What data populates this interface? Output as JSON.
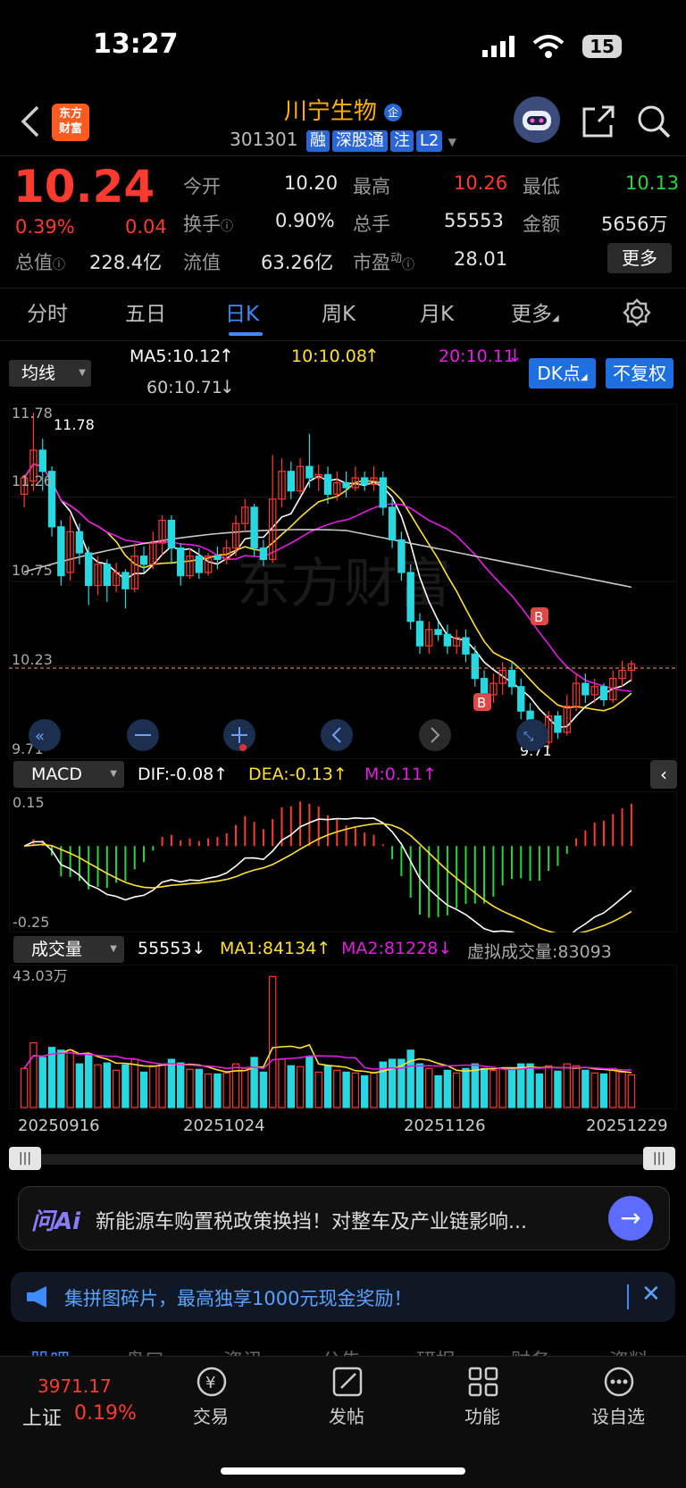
{
  "status": {
    "time": "13:27",
    "battery": "15"
  },
  "header": {
    "logo_line1": "东方",
    "logo_line2": "财富",
    "name": "川宁生物",
    "name_badge": "企",
    "code": "301301",
    "tags": [
      "融",
      "深股通",
      "注",
      "L2"
    ]
  },
  "quote": {
    "price": "10.24",
    "change_pct": "0.39%",
    "change": "0.04",
    "open_label": "今开",
    "open": "10.20",
    "high_label": "最高",
    "high": "10.26",
    "low_label": "最低",
    "low": "10.13",
    "turnover_label": "换手",
    "turnover": "0.90%",
    "volume_label": "总手",
    "volume": "55553",
    "amount_label": "金额",
    "amount": "5656万",
    "mcap_label": "总值",
    "mcap": "228.4亿",
    "float_label": "流值",
    "float": "63.26亿",
    "pe_label": "市盈",
    "pe_sup": "动",
    "pe": "28.01",
    "more_button": "更多"
  },
  "tabs": [
    "分时",
    "五日",
    "日K",
    "周K",
    "月K",
    "更多"
  ],
  "active_tab": "日K",
  "kline": {
    "ma_select": "均线",
    "ma5": "MA5:10.12",
    "ma10": "10:10.08",
    "ma20": "20:10.11",
    "ma60": "60:10.71",
    "dk_button": "DK点",
    "fq_button": "不复权",
    "y_labels": [
      "11.78",
      "11.26",
      "10.75",
      "10.23",
      "9.71"
    ],
    "max_label": "11.78",
    "min_label": "9.71",
    "watermark": "东方财富",
    "b_marker": "B",
    "colors": {
      "up": "#ff3b30",
      "down": "#28d8e0",
      "ma5": "#ffffff",
      "ma10": "#ffe033",
      "ma20": "#e020e0",
      "ma60": "#c8c8c8"
    }
  },
  "chart_data": [
    {
      "type": "candlestick",
      "y_range": [
        9.71,
        11.78
      ],
      "x_labels": [
        "20250916",
        "20251024",
        "20251126",
        "20251229"
      ],
      "max_price": 11.78,
      "min_price": 9.71,
      "last_close": 10.24,
      "ma": {
        "ma5": 10.12,
        "ma10": 10.08,
        "ma20": 10.11,
        "ma60": 10.71
      },
      "candles": [
        [
          11.28,
          11.38,
          11.4,
          11.2
        ],
        [
          11.36,
          11.55,
          11.78,
          11.3
        ],
        [
          11.55,
          11.42,
          11.62,
          11.3
        ],
        [
          11.42,
          11.08,
          11.45,
          11.02
        ],
        [
          11.08,
          10.78,
          11.12,
          10.72
        ],
        [
          10.8,
          11.05,
          11.15,
          10.75
        ],
        [
          11.05,
          10.92,
          11.1,
          10.85
        ],
        [
          10.92,
          10.72,
          10.96,
          10.6
        ],
        [
          10.72,
          10.85,
          10.9,
          10.66
        ],
        [
          10.85,
          10.72,
          10.88,
          10.62
        ],
        [
          10.72,
          10.8,
          10.86,
          10.68
        ],
        [
          10.8,
          10.7,
          10.82,
          10.58
        ],
        [
          10.7,
          10.9,
          10.98,
          10.68
        ],
        [
          10.9,
          10.85,
          10.96,
          10.8
        ],
        [
          10.85,
          10.98,
          11.05,
          10.82
        ],
        [
          10.98,
          11.12,
          11.15,
          10.9
        ],
        [
          11.12,
          10.95,
          11.15,
          10.85
        ],
        [
          10.95,
          10.78,
          10.98,
          10.72
        ],
        [
          10.78,
          10.9,
          10.95,
          10.76
        ],
        [
          10.9,
          10.8,
          10.95,
          10.76
        ],
        [
          10.8,
          10.9,
          10.92,
          10.78
        ],
        [
          10.9,
          10.88,
          10.96,
          10.82
        ],
        [
          10.88,
          10.95,
          11.0,
          10.85
        ],
        [
          10.95,
          11.1,
          11.15,
          10.9
        ],
        [
          11.1,
          11.2,
          11.25,
          11.05
        ],
        [
          11.2,
          10.95,
          11.22,
          10.9
        ],
        [
          10.95,
          10.88,
          11.0,
          10.84
        ],
        [
          10.88,
          11.25,
          11.52,
          10.86
        ],
        [
          11.25,
          11.42,
          11.5,
          11.2
        ],
        [
          11.42,
          11.3,
          11.48,
          11.25
        ],
        [
          11.3,
          11.45,
          11.5,
          11.28
        ],
        [
          11.45,
          11.38,
          11.65,
          11.32
        ],
        [
          11.38,
          11.4,
          11.46,
          11.3
        ],
        [
          11.4,
          11.28,
          11.45,
          11.22
        ],
        [
          11.28,
          11.35,
          11.42,
          11.24
        ],
        [
          11.35,
          11.32,
          11.42,
          11.26
        ],
        [
          11.32,
          11.38,
          11.45,
          11.3
        ],
        [
          11.38,
          11.34,
          11.42,
          11.3
        ],
        [
          11.34,
          11.38,
          11.45,
          11.3
        ],
        [
          11.38,
          11.2,
          11.42,
          11.15
        ],
        [
          11.2,
          11.0,
          11.25,
          10.95
        ],
        [
          11.0,
          10.8,
          11.05,
          10.75
        ],
        [
          10.8,
          10.5,
          10.85,
          10.45
        ],
        [
          10.5,
          10.35,
          10.55,
          10.3
        ],
        [
          10.35,
          10.45,
          10.5,
          10.3
        ],
        [
          10.45,
          10.42,
          10.5,
          10.38
        ],
        [
          10.42,
          10.35,
          10.48,
          10.3
        ],
        [
          10.35,
          10.4,
          10.45,
          10.3
        ],
        [
          10.4,
          10.3,
          10.45,
          10.25
        ],
        [
          10.3,
          10.15,
          10.35,
          10.1
        ],
        [
          10.15,
          10.05,
          10.2,
          10.0
        ],
        [
          10.05,
          10.12,
          10.18,
          10.0
        ],
        [
          10.12,
          10.2,
          10.25,
          10.05
        ],
        [
          10.2,
          10.1,
          10.25,
          10.05
        ],
        [
          10.1,
          9.95,
          10.15,
          9.9
        ],
        [
          9.95,
          9.8,
          10.0,
          9.75
        ],
        [
          9.8,
          9.76,
          9.85,
          9.71
        ],
        [
          9.76,
          9.92,
          9.95,
          9.72
        ],
        [
          9.92,
          9.82,
          9.95,
          9.78
        ],
        [
          9.82,
          9.98,
          10.05,
          9.8
        ],
        [
          9.98,
          10.12,
          10.18,
          9.95
        ],
        [
          10.12,
          10.05,
          10.18,
          10.0
        ],
        [
          10.05,
          10.1,
          10.15,
          10.0
        ],
        [
          10.1,
          10.02,
          10.12,
          9.98
        ],
        [
          10.02,
          10.15,
          10.2,
          10.0
        ],
        [
          10.15,
          10.2,
          10.26,
          10.1
        ],
        [
          10.2,
          10.24,
          10.26,
          10.13
        ]
      ]
    },
    {
      "type": "bar",
      "name": "MACD",
      "dif": "DIF:-0.08",
      "dea": "DEA:-0.13",
      "m": "M:0.11",
      "y_range": [
        -0.25,
        0.15
      ]
    },
    {
      "type": "bar",
      "name": "成交量",
      "max_label": "43.03万",
      "volume": "55553",
      "ma1": "MA1:84134",
      "ma2": "MA2:81228",
      "virtual": "虚拟成交量:83093"
    }
  ],
  "macd": {
    "select": "MACD",
    "dif": "DIF:-0.08",
    "dea": "DEA:-0.13",
    "m": "M:0.11",
    "top": "0.15",
    "bottom": "-0.25"
  },
  "volume": {
    "select": "成交量",
    "value": "55553",
    "ma1": "MA1:84134",
    "ma2": "MA2:81228",
    "virtual": "虚拟成交量:83093",
    "max": "43.03万"
  },
  "dates": [
    "20250916",
    "20251024",
    "20251126",
    "20251229"
  ],
  "ai_banner": {
    "brand": "问Ai",
    "text": "新能源车购置税政策换挡！对整车及产业链影响..."
  },
  "promo": {
    "text": "集拼图碎片，最高独享1000元现金奖励！"
  },
  "sub_tabs": [
    "股吧",
    "盘口",
    "资讯",
    "公告",
    "研报",
    "财务",
    "资料"
  ],
  "bottom_nav": {
    "index_value": "3971.17",
    "index_name": "上证",
    "index_change": "0.19%",
    "items": [
      "交易",
      "发帖",
      "功能",
      "设自选"
    ]
  }
}
